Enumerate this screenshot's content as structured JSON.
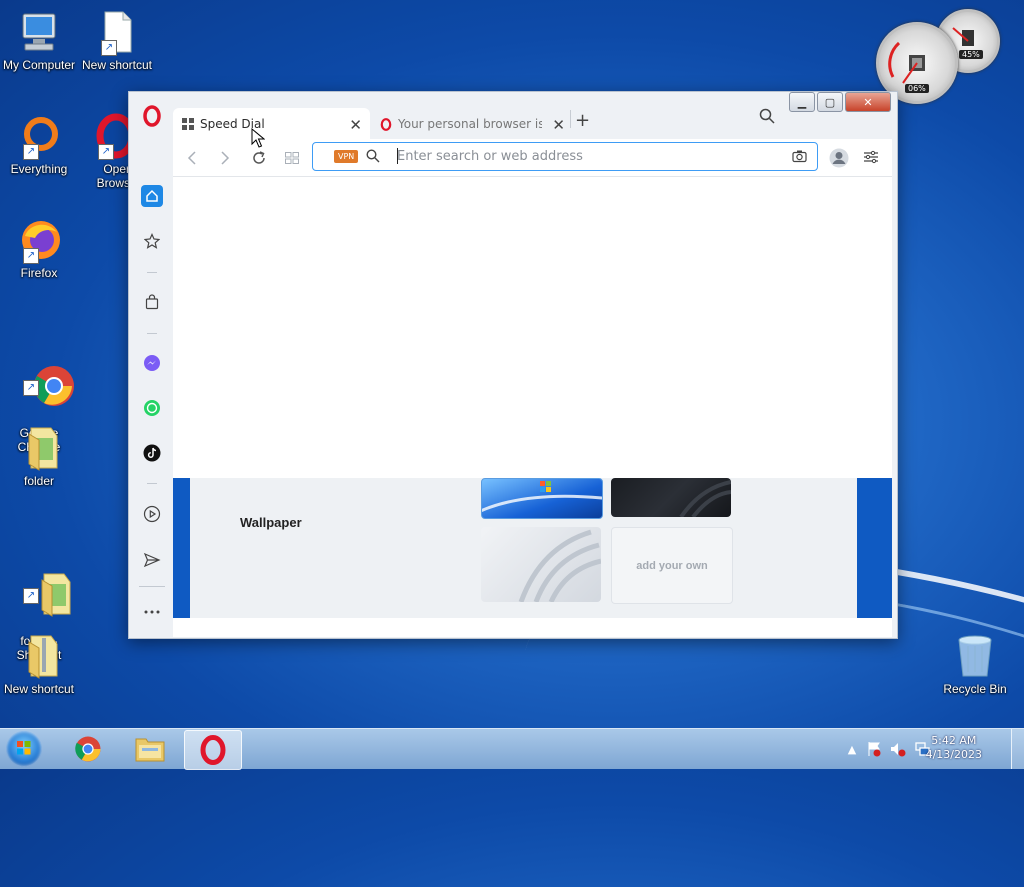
{
  "desktop": {
    "icons": [
      {
        "label": "My Computer"
      },
      {
        "label": "New shortcut"
      },
      {
        "label": "Everything"
      },
      {
        "label": "Oper\nBrows"
      },
      {
        "label": "Firefox"
      },
      {
        "label": "Google\nChrome"
      },
      {
        "label": "folder"
      },
      {
        "label": "folder -\nShortcut"
      },
      {
        "label": "New shortcut"
      },
      {
        "label": "Recycle Bin"
      }
    ],
    "gadget": {
      "cpu_percent": "06%",
      "memory_percent": "45%"
    }
  },
  "browser": {
    "tabs": [
      {
        "title": "Speed Dial",
        "active": true
      },
      {
        "title": "Your personal browser is a",
        "active": false
      }
    ],
    "address": {
      "placeholder": "Enter search or web address",
      "value": "",
      "vpn_badge": "VPN"
    },
    "speed_dial": {
      "wallpaper_label": "Wallpaper",
      "add_your_own": "add your own"
    }
  },
  "taskbar": {
    "time": "5:42 AM",
    "date": "4/13/2023"
  },
  "colors": {
    "accent": "#1e88e5",
    "opera_red": "#e0162b",
    "vpn_orange": "#e07a2a"
  }
}
